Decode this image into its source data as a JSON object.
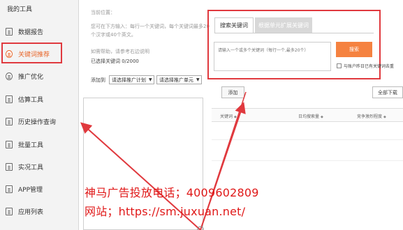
{
  "sidebar": {
    "title": "我的工具",
    "items": [
      {
        "label": "数据报告",
        "icon": "report-icon"
      },
      {
        "label": "关键词推荐",
        "icon": "keyword-icon",
        "active": true
      },
      {
        "label": "推广优化",
        "icon": "optimize-icon"
      },
      {
        "label": "估算工具",
        "icon": "estimate-icon"
      },
      {
        "label": "历史操作查询",
        "icon": "history-icon"
      },
      {
        "label": "批量工具",
        "icon": "batch-icon"
      },
      {
        "label": "实况工具",
        "icon": "live-icon"
      },
      {
        "label": "APP管理",
        "icon": "app-icon"
      },
      {
        "label": "应用列表",
        "icon": "list-icon"
      }
    ]
  },
  "middle": {
    "position_label": "当前位置：",
    "hint_line1": "您可在下方输入：每行一个关键词，每个关键词最多20",
    "hint_line2": "个汉字或40个英文。",
    "hint_line3": "如需帮助，请参考右边说明",
    "selected_count": "已选择关键词 0/2000",
    "add_to_label": "添加到",
    "select_plan": "请选择推广计划",
    "select_unit": "请选择推广单元"
  },
  "right": {
    "tab_active": "搜索关键词",
    "tab_inactive": "根据单元扩展关键词",
    "input_placeholder": "请输入一个或多个关键词（每行一个,最多20个）",
    "search_button": "搜索",
    "checkbox_label": "与账户昨日已有关键词去重",
    "add_button": "添加",
    "download_button": "全部下载",
    "columns": [
      "关键词",
      "日均搜索量",
      "竞争激烈程度"
    ]
  },
  "overlay": {
    "phone_line": "神马广告投放电话；4009602809",
    "site_line": "网站；https://sm.juxuan.net/"
  },
  "colors": {
    "highlight": "#e0393e",
    "accent": "#f58240",
    "watermark": "#e01818"
  }
}
